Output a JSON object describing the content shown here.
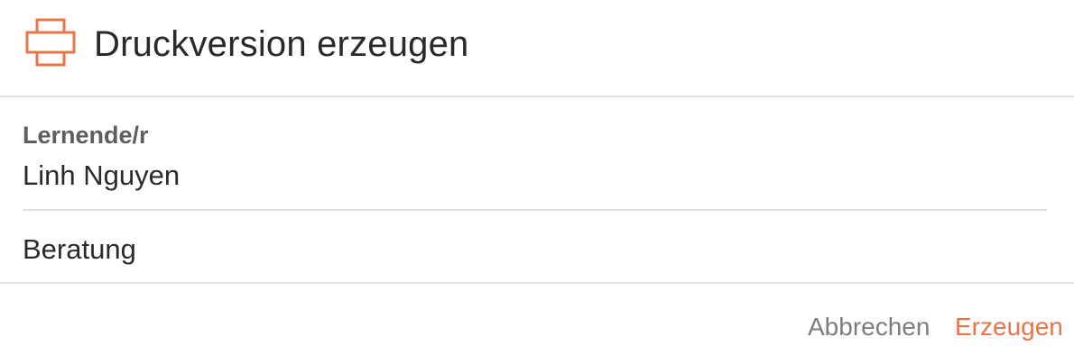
{
  "dialog": {
    "title": "Druckversion erzeugen",
    "icon": "printer-icon",
    "accent_color": "#e87447"
  },
  "student": {
    "label": "Lernende/r",
    "value": "Linh Nguyen"
  },
  "topic": {
    "value": "Beratung"
  },
  "footer": {
    "cancel_label": "Abbrechen",
    "create_label": "Erzeugen"
  }
}
